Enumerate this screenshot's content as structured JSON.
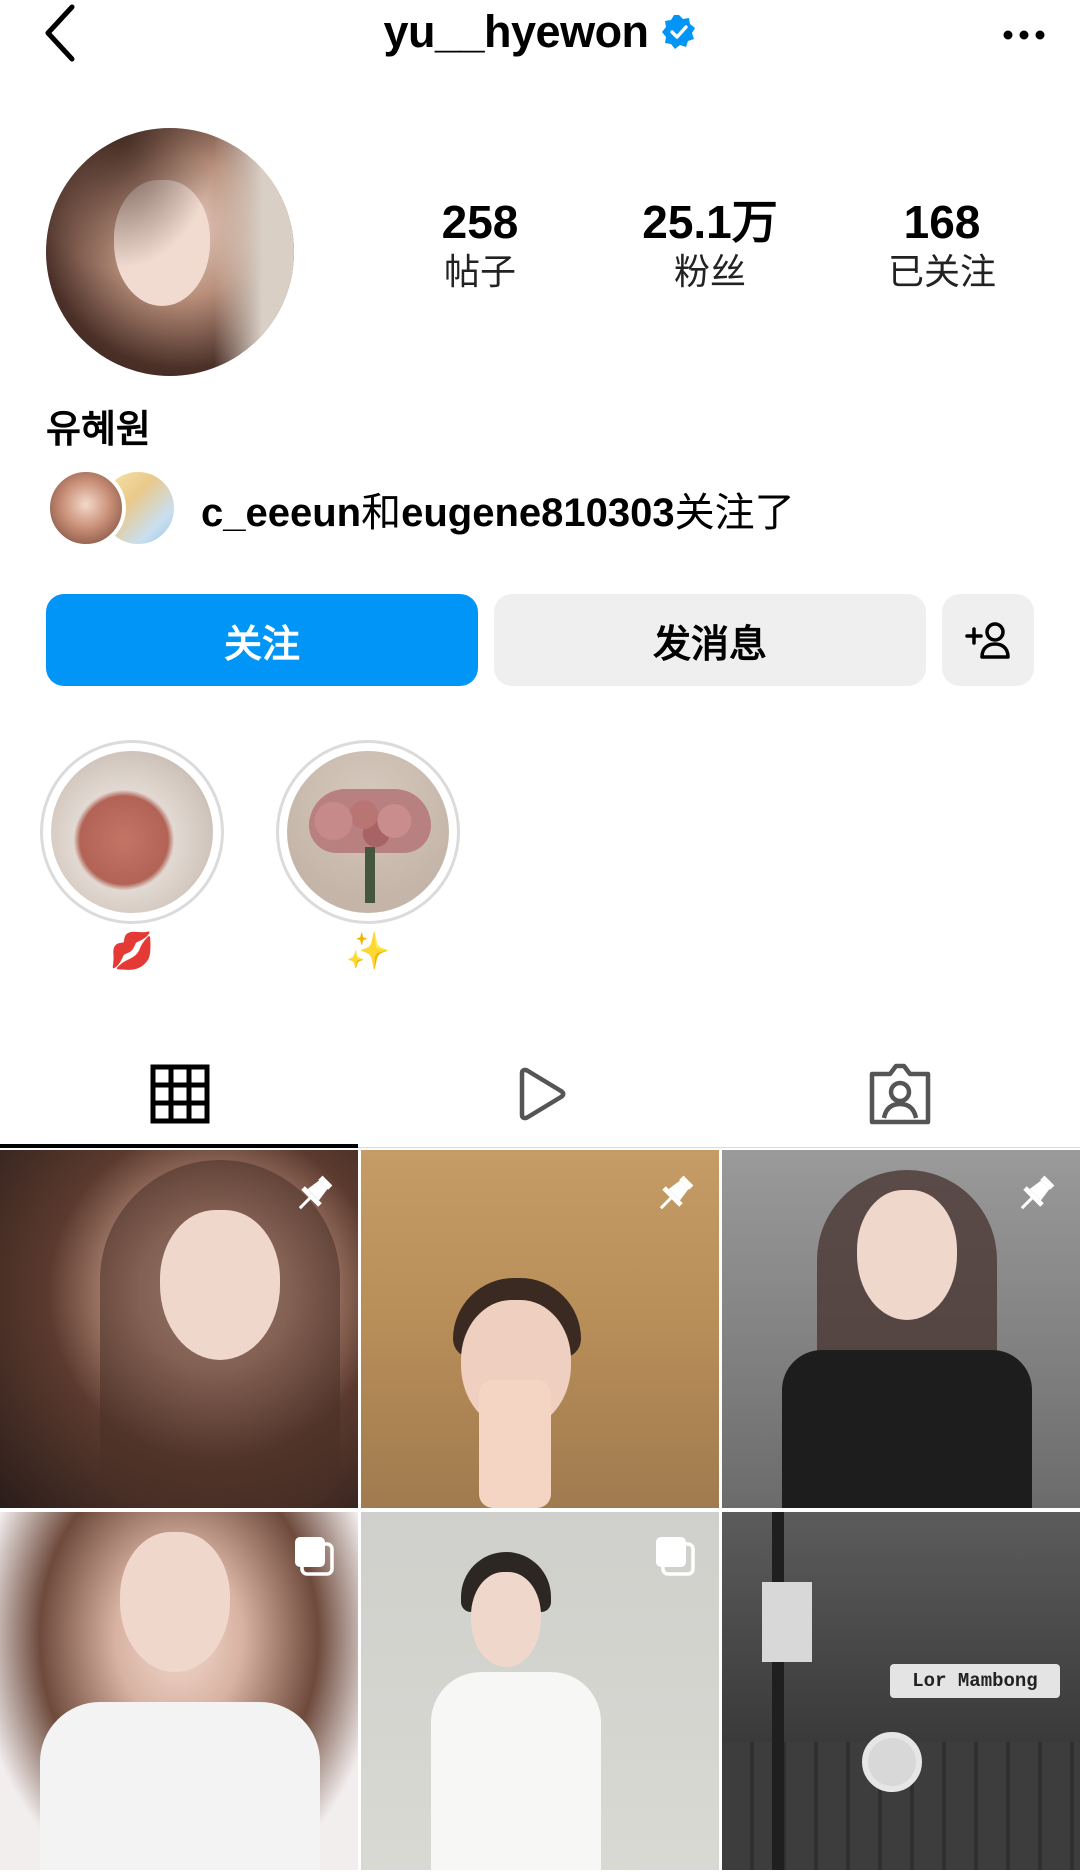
{
  "header": {
    "username": "yu__hyewon",
    "verified": true
  },
  "profile": {
    "display_name": "유혜원",
    "stats": [
      {
        "value": "258",
        "label": "帖子"
      },
      {
        "value": "25.1万",
        "label": "粉丝"
      },
      {
        "value": "168",
        "label": "已关注"
      }
    ],
    "mutual": {
      "user1": "c_eeeun",
      "conjunction": "和",
      "user2": "eugene810303",
      "suffix": "关注了"
    }
  },
  "actions": {
    "follow_label": "关注",
    "message_label": "发消息",
    "follow_color": "#0095f6"
  },
  "highlights": [
    {
      "label": "💋"
    },
    {
      "label": "✨"
    }
  ],
  "tabs": [
    {
      "icon": "grid-icon",
      "active": true
    },
    {
      "icon": "reels-icon",
      "active": false
    },
    {
      "icon": "tagged-icon",
      "active": false
    }
  ],
  "posts": [
    {
      "overlay": "pin-icon"
    },
    {
      "overlay": "pin-icon"
    },
    {
      "overlay": "pin-icon"
    },
    {
      "overlay": "carousel-icon"
    },
    {
      "overlay": "carousel-icon"
    },
    {
      "overlay": "none",
      "sign_text": "Lor Mambong"
    }
  ]
}
